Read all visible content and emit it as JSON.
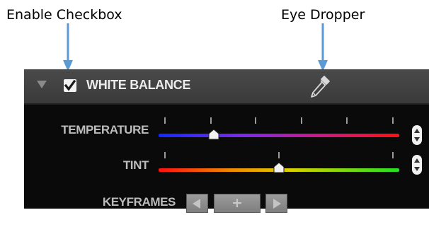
{
  "annotations": {
    "enable_checkbox_label": "Enable Checkbox",
    "eye_dropper_label": "Eye Dropper",
    "arrow_color": "#5b9bd5"
  },
  "panel": {
    "title": "WHITE BALANCE",
    "collapsed": false,
    "enabled": true,
    "eyedropper_icon": "eyedropper-icon",
    "temperature": {
      "label": "TEMPERATURE",
      "value_fraction": 0.23,
      "gradient_colors": [
        "#1428ff",
        "#7a2aee",
        "#c8198c",
        "#ff1010"
      ]
    },
    "tint": {
      "label": "TINT",
      "value_fraction": 0.5,
      "gradient_colors": [
        "#ff1010",
        "#f08a00",
        "#d9d000",
        "#22e022"
      ]
    },
    "keyframes": {
      "label": "KEYFRAMES",
      "add_symbol": "+",
      "prev_icon": "triangle-left-icon",
      "next_icon": "triangle-right-icon"
    }
  }
}
